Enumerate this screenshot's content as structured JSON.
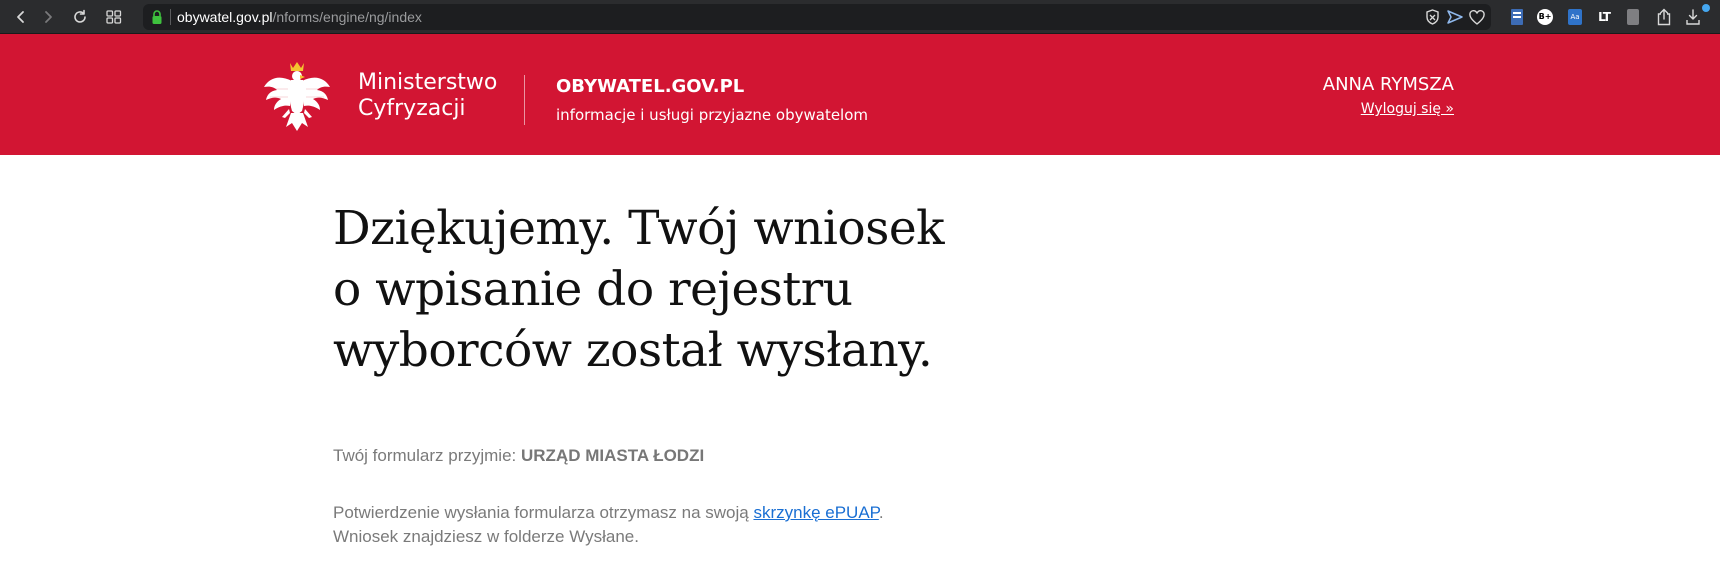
{
  "browser": {
    "url_domain": "obywatel.gov.pl",
    "url_path": "/nforms/engine/ng/index",
    "icons": {
      "back": "chevron-left-icon",
      "forward": "chevron-right-icon",
      "reload": "reload-icon",
      "tabs": "grid-icon",
      "lock": "lock-icon",
      "shield": "shield-icon",
      "send": "send-icon",
      "heart": "heart-icon",
      "share": "share-icon",
      "download": "download-icon"
    },
    "extensions": {
      "badge_label": "B+",
      "blue_label": "Aa",
      "lt_label": "LT"
    }
  },
  "header": {
    "ministry_line1": "Ministerstwo",
    "ministry_line2": "Cyfryzacji",
    "portal_name": "OBYWATEL.GOV.PL",
    "portal_tagline": "informacje i usługi przyjazne obywatelom",
    "user_name": "ANNA RYMSZA",
    "logout_label": "Wyloguj się »",
    "brand_color": "#d21533"
  },
  "main": {
    "title_line1": "Dziękujemy. Twój wniosek",
    "title_line2": "o wpisanie do rejestru",
    "title_line3": "wyborców został wysłany.",
    "recipient_label": "Twój formularz przyjmie: ",
    "recipient_name": "URZĄD MIASTA ŁODZI",
    "confirm_text_before": "Potwierdzenie wysłania formularza otrzymasz na swoją ",
    "confirm_link": "skrzynkę ePUAP",
    "confirm_text_after": ".",
    "confirm_line2": "Wniosek znajdziesz w folderze Wysłane.",
    "link_color": "#1a6fd3"
  }
}
